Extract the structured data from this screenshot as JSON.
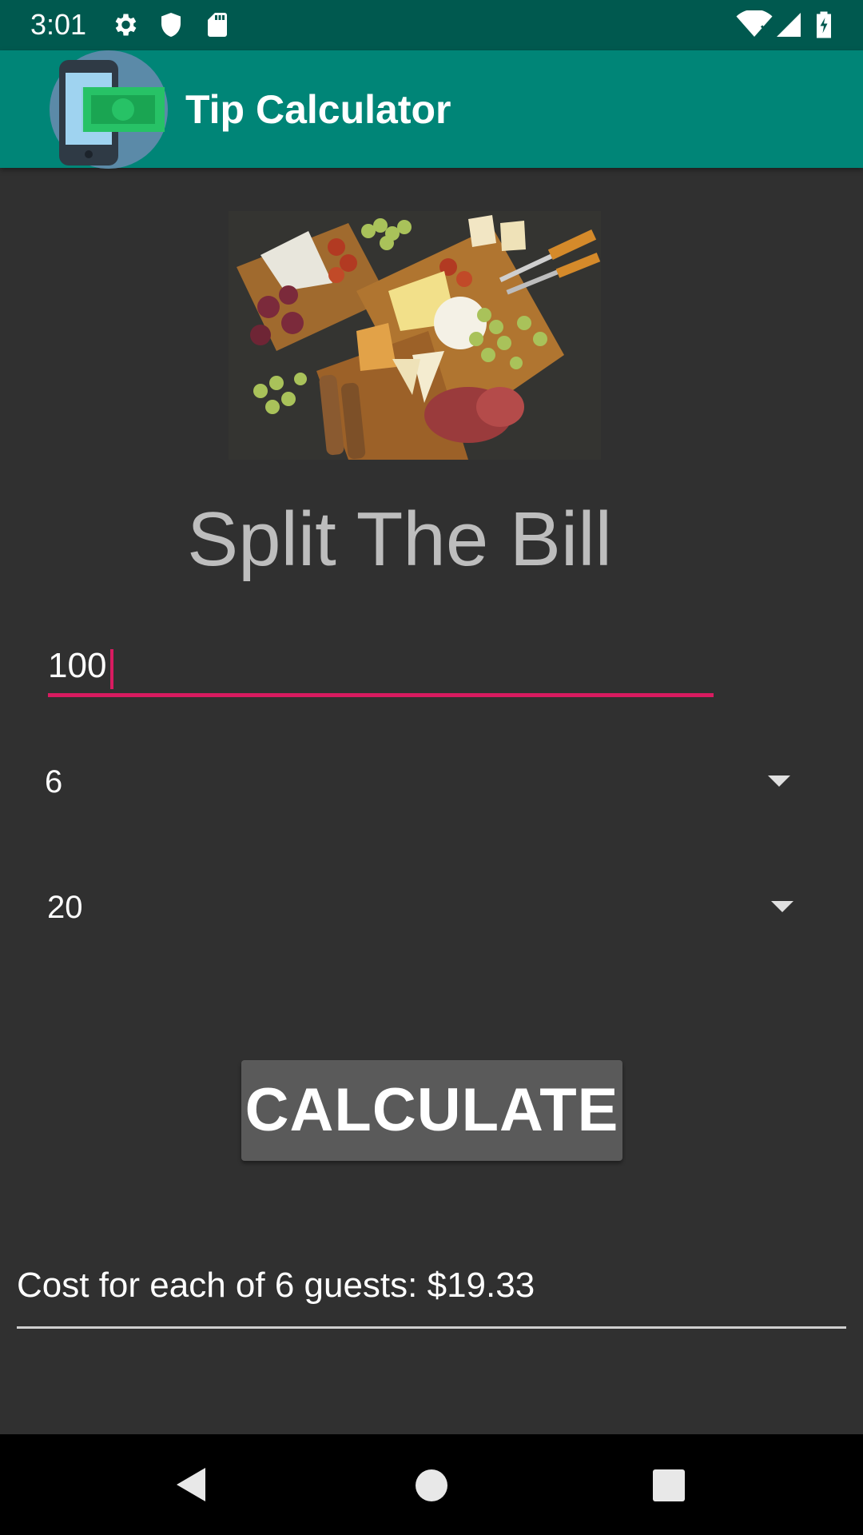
{
  "status_bar": {
    "time": "3:01",
    "icons": [
      "gear-icon",
      "shield-icon",
      "sd-card-icon",
      "wifi-icon",
      "signal-icon",
      "battery-icon"
    ]
  },
  "app_bar": {
    "title": "Tip Calculator",
    "logo_icon": "phone-money-icon",
    "color": "#008577"
  },
  "main": {
    "heading": "Split The Bill",
    "bill_input": {
      "value": "100"
    },
    "guests_spinner": {
      "selected": "6"
    },
    "tip_spinner": {
      "selected": "20"
    },
    "calculate_button": {
      "label": "CALCULATE"
    },
    "result": {
      "text": "Cost for each of 6 guests: $19.33"
    },
    "accent_color": "#d81b60"
  },
  "nav_bar": {
    "icons": [
      "back-icon",
      "home-icon",
      "recents-icon"
    ]
  }
}
